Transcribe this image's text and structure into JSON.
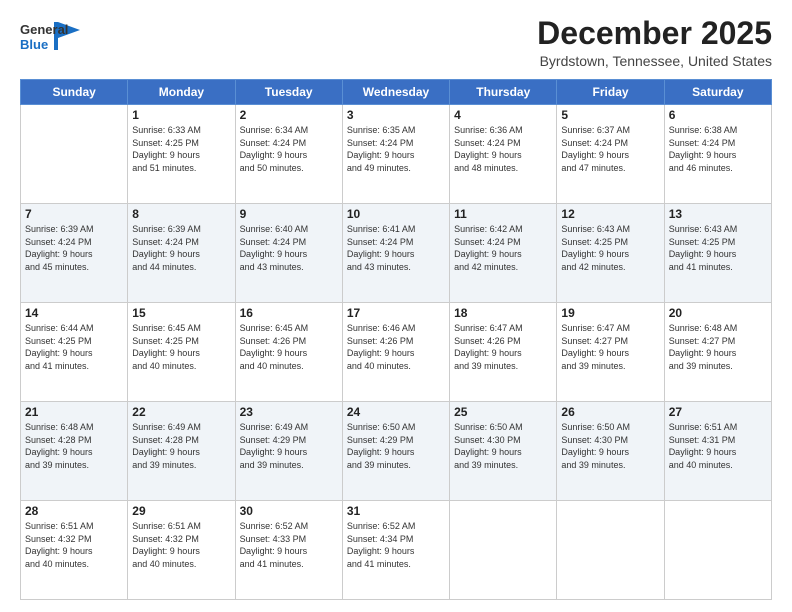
{
  "logo": {
    "general": "General",
    "blue": "Blue"
  },
  "header": {
    "month": "December 2025",
    "location": "Byrdstown, Tennessee, United States"
  },
  "weekdays": [
    "Sunday",
    "Monday",
    "Tuesday",
    "Wednesday",
    "Thursday",
    "Friday",
    "Saturday"
  ],
  "weeks": [
    [
      {
        "day": "",
        "info": ""
      },
      {
        "day": "1",
        "info": "Sunrise: 6:33 AM\nSunset: 4:25 PM\nDaylight: 9 hours\nand 51 minutes."
      },
      {
        "day": "2",
        "info": "Sunrise: 6:34 AM\nSunset: 4:24 PM\nDaylight: 9 hours\nand 50 minutes."
      },
      {
        "day": "3",
        "info": "Sunrise: 6:35 AM\nSunset: 4:24 PM\nDaylight: 9 hours\nand 49 minutes."
      },
      {
        "day": "4",
        "info": "Sunrise: 6:36 AM\nSunset: 4:24 PM\nDaylight: 9 hours\nand 48 minutes."
      },
      {
        "day": "5",
        "info": "Sunrise: 6:37 AM\nSunset: 4:24 PM\nDaylight: 9 hours\nand 47 minutes."
      },
      {
        "day": "6",
        "info": "Sunrise: 6:38 AM\nSunset: 4:24 PM\nDaylight: 9 hours\nand 46 minutes."
      }
    ],
    [
      {
        "day": "7",
        "info": "Sunrise: 6:39 AM\nSunset: 4:24 PM\nDaylight: 9 hours\nand 45 minutes."
      },
      {
        "day": "8",
        "info": "Sunrise: 6:39 AM\nSunset: 4:24 PM\nDaylight: 9 hours\nand 44 minutes."
      },
      {
        "day": "9",
        "info": "Sunrise: 6:40 AM\nSunset: 4:24 PM\nDaylight: 9 hours\nand 43 minutes."
      },
      {
        "day": "10",
        "info": "Sunrise: 6:41 AM\nSunset: 4:24 PM\nDaylight: 9 hours\nand 43 minutes."
      },
      {
        "day": "11",
        "info": "Sunrise: 6:42 AM\nSunset: 4:24 PM\nDaylight: 9 hours\nand 42 minutes."
      },
      {
        "day": "12",
        "info": "Sunrise: 6:43 AM\nSunset: 4:25 PM\nDaylight: 9 hours\nand 42 minutes."
      },
      {
        "day": "13",
        "info": "Sunrise: 6:43 AM\nSunset: 4:25 PM\nDaylight: 9 hours\nand 41 minutes."
      }
    ],
    [
      {
        "day": "14",
        "info": "Sunrise: 6:44 AM\nSunset: 4:25 PM\nDaylight: 9 hours\nand 41 minutes."
      },
      {
        "day": "15",
        "info": "Sunrise: 6:45 AM\nSunset: 4:25 PM\nDaylight: 9 hours\nand 40 minutes."
      },
      {
        "day": "16",
        "info": "Sunrise: 6:45 AM\nSunset: 4:26 PM\nDaylight: 9 hours\nand 40 minutes."
      },
      {
        "day": "17",
        "info": "Sunrise: 6:46 AM\nSunset: 4:26 PM\nDaylight: 9 hours\nand 40 minutes."
      },
      {
        "day": "18",
        "info": "Sunrise: 6:47 AM\nSunset: 4:26 PM\nDaylight: 9 hours\nand 39 minutes."
      },
      {
        "day": "19",
        "info": "Sunrise: 6:47 AM\nSunset: 4:27 PM\nDaylight: 9 hours\nand 39 minutes."
      },
      {
        "day": "20",
        "info": "Sunrise: 6:48 AM\nSunset: 4:27 PM\nDaylight: 9 hours\nand 39 minutes."
      }
    ],
    [
      {
        "day": "21",
        "info": "Sunrise: 6:48 AM\nSunset: 4:28 PM\nDaylight: 9 hours\nand 39 minutes."
      },
      {
        "day": "22",
        "info": "Sunrise: 6:49 AM\nSunset: 4:28 PM\nDaylight: 9 hours\nand 39 minutes."
      },
      {
        "day": "23",
        "info": "Sunrise: 6:49 AM\nSunset: 4:29 PM\nDaylight: 9 hours\nand 39 minutes."
      },
      {
        "day": "24",
        "info": "Sunrise: 6:50 AM\nSunset: 4:29 PM\nDaylight: 9 hours\nand 39 minutes."
      },
      {
        "day": "25",
        "info": "Sunrise: 6:50 AM\nSunset: 4:30 PM\nDaylight: 9 hours\nand 39 minutes."
      },
      {
        "day": "26",
        "info": "Sunrise: 6:50 AM\nSunset: 4:30 PM\nDaylight: 9 hours\nand 39 minutes."
      },
      {
        "day": "27",
        "info": "Sunrise: 6:51 AM\nSunset: 4:31 PM\nDaylight: 9 hours\nand 40 minutes."
      }
    ],
    [
      {
        "day": "28",
        "info": "Sunrise: 6:51 AM\nSunset: 4:32 PM\nDaylight: 9 hours\nand 40 minutes."
      },
      {
        "day": "29",
        "info": "Sunrise: 6:51 AM\nSunset: 4:32 PM\nDaylight: 9 hours\nand 40 minutes."
      },
      {
        "day": "30",
        "info": "Sunrise: 6:52 AM\nSunset: 4:33 PM\nDaylight: 9 hours\nand 41 minutes."
      },
      {
        "day": "31",
        "info": "Sunrise: 6:52 AM\nSunset: 4:34 PM\nDaylight: 9 hours\nand 41 minutes."
      },
      {
        "day": "",
        "info": ""
      },
      {
        "day": "",
        "info": ""
      },
      {
        "day": "",
        "info": ""
      }
    ]
  ],
  "row_classes": [
    "row-white",
    "row-shaded",
    "row-white",
    "row-shaded",
    "row-white"
  ]
}
